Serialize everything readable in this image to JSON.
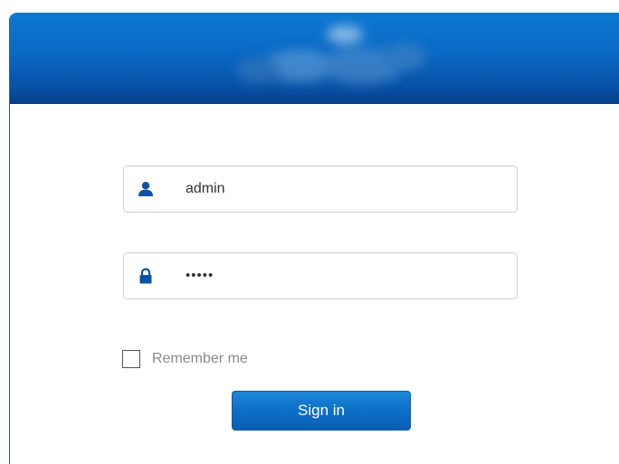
{
  "login_form": {
    "username_value": "admin",
    "password_value": "•••••",
    "remember_label": "Remember me",
    "remember_checked": false,
    "signin_label": "Sign in"
  },
  "icons": {
    "username": "user-icon",
    "password": "lock-icon"
  },
  "colors": {
    "header_top": "#0c78d2",
    "header_bottom": "#063f8a",
    "accent": "#0a5fb3",
    "icon": "#0b53a8"
  }
}
